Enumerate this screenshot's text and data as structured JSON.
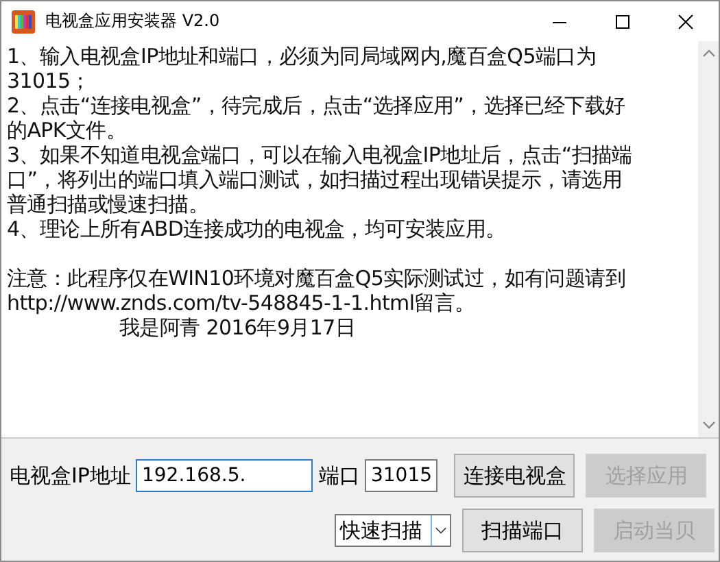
{
  "window": {
    "title": "电视盒应用安装器 V2.0"
  },
  "instructions": [
    {
      "lines": [
        "1、输入电视盒IP地址和端口，必须为同局域网内,魔百盒Q5端口为",
        "31015；"
      ]
    },
    {
      "lines": [
        "2、点击“连接电视盒”，待完成后，点击“选择应用”，选择已经下载好",
        "的APK文件。"
      ]
    },
    {
      "lines": [
        "3、如果不知道电视盒端口，可以在输入电视盒IP地址后，点击“扫描端",
        "口”，将列出的端口填入端口测试，如扫描过程出现错误提示，请选用",
        "普通扫描或慢速扫描。"
      ]
    },
    {
      "lines": [
        "4、理论上所有ABD连接成功的电视盒，均可安装应用。"
      ]
    }
  ],
  "note": {
    "lines": [
      "注意：此程序仅在WIN10环境对魔百盒Q5实际测试过，如有问题请到",
      "http://www.znds.com/tv-548845-1-1.html留言。"
    ]
  },
  "signature": "我是阿青 2016年9月17日",
  "ip": {
    "label": "电视盒IP地址",
    "value": "192.168.5.",
    "focused": true
  },
  "port": {
    "label": "端口",
    "value": "31015"
  },
  "scan_mode": {
    "value": "快速扫描"
  },
  "buttons": [
    {
      "label": "连接电视盒",
      "disabled": false
    },
    {
      "label": "选择应用",
      "disabled": true
    },
    {
      "label": "扫描端口",
      "disabled": false
    },
    {
      "label": "启动当贝",
      "disabled": true
    }
  ]
}
